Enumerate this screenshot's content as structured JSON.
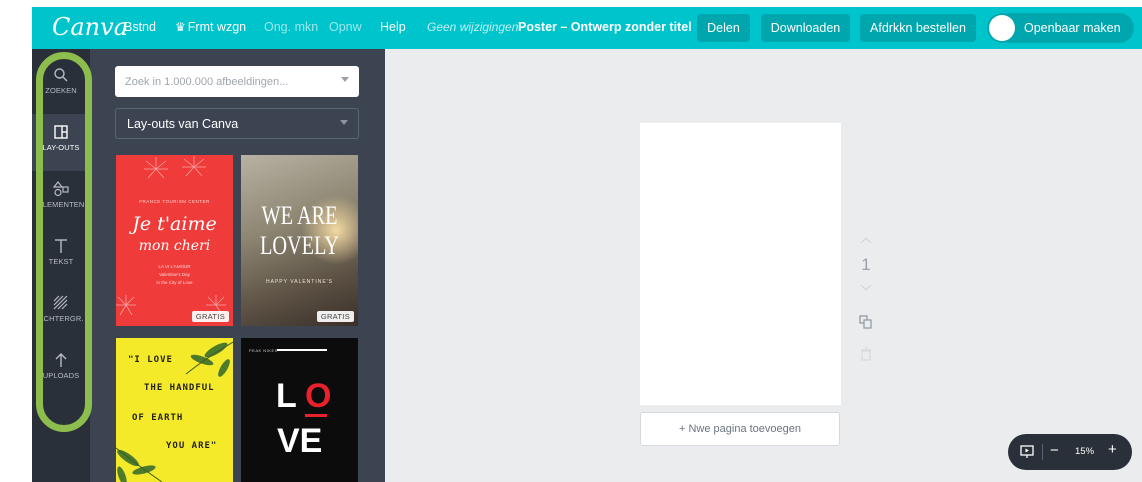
{
  "app": {
    "logo": "Canva",
    "nav": [
      "Bstnd",
      "Frmt wzgn",
      "Ong. mkn",
      "Opnw",
      "Help"
    ],
    "status": "Geen wijzigingen",
    "doc_title": "Poster – Ontwerp zonder titel",
    "buttons": {
      "share": "Delen",
      "download": "Downloaden",
      "order": "Afdrkkn bestellen"
    },
    "publish_label": "Openbaar maken",
    "brand_color": "#00c4cc"
  },
  "rail": {
    "items": [
      {
        "label": "ZOEKEN",
        "icon": "search-icon"
      },
      {
        "label": "LAY-OUTS",
        "icon": "layouts-icon"
      },
      {
        "label": "ELEMENTEN",
        "icon": "elements-icon"
      },
      {
        "label": "TEKST",
        "icon": "text-icon"
      },
      {
        "label": "ACHTERGR.",
        "icon": "background-icon"
      },
      {
        "label": "UPLOADS",
        "icon": "upload-icon"
      }
    ],
    "active_index": 1,
    "annotation_color": "#8dbd4c"
  },
  "panel": {
    "search_placeholder": "Zoek in 1.000.000 afbeeldingen...",
    "layout_select": "Lay-outs van Canva",
    "free_badge": "GRATIS",
    "templates": [
      {
        "kicker": "FRANCE TOURISM CENTER",
        "title_line1": "Je t'aime",
        "title_line2": "mon cheri",
        "small": [
          "LA VI L'AMOUR",
          "Valentine's Day",
          "in the City of Love"
        ]
      },
      {
        "title_line1": "WE ARE",
        "title_line2": "LOVELY",
        "small": [
          "HAPPY VALENTINE'S"
        ]
      },
      {
        "lines": [
          "\"I LOVE",
          "THE HANDFUL",
          "OF EARTH",
          "YOU ARE\""
        ]
      },
      {
        "kicker": "PEAK NIKES",
        "row1": [
          "L",
          "O"
        ],
        "row2": "VE"
      }
    ]
  },
  "canvas": {
    "page_number": "1",
    "add_page": "+ Nwe pagina toevoegen",
    "zoom": "15%"
  }
}
